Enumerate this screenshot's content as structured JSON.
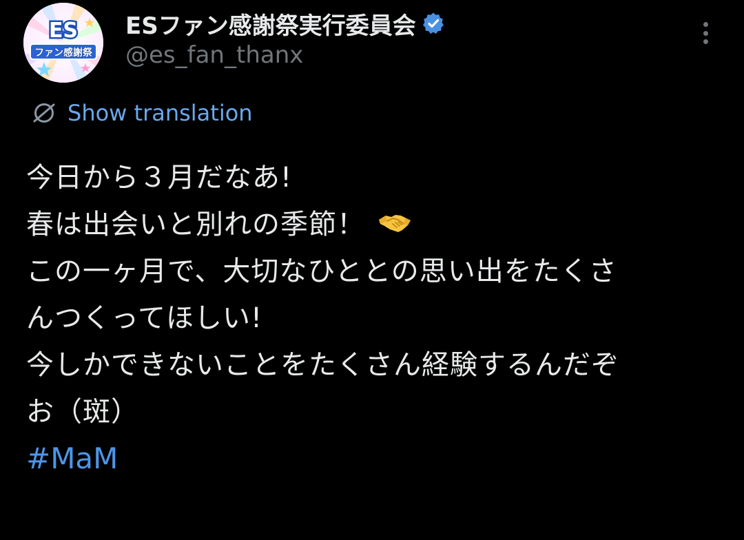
{
  "author": {
    "display_name": "ESファン感謝祭実行委員会",
    "handle": "@es_fan_thanx",
    "verified": true,
    "avatar_icon": "es-fan-thanks-logo",
    "avatar_text": "ES ファン感謝祭"
  },
  "translation": {
    "label": "Show translation",
    "icon": "globe-icon"
  },
  "tweet": {
    "lines": [
      "今日から３月だなあ!",
      "春は出会いと別れの季節！",
      "この一ヶ月で、大切なひととの思い出をたくさ",
      "んつくってほしい!",
      "今しかできないことをたくさん経験するんだぞ",
      "お（斑）"
    ],
    "emoji": "handshake",
    "hashtag": "#MaM"
  },
  "colors": {
    "background": "#000000",
    "text": "#e7e9ea",
    "secondary": "#71767b",
    "link": "#4d95e8",
    "verified": "#4a90e2"
  }
}
